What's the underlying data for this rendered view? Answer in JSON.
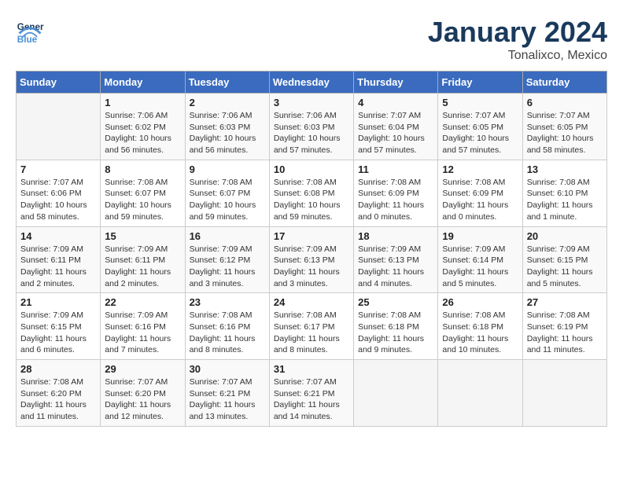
{
  "header": {
    "logo_general": "General",
    "logo_blue": "Blue",
    "title": "January 2024",
    "subtitle": "Tonalixco, Mexico"
  },
  "days_of_week": [
    "Sunday",
    "Monday",
    "Tuesday",
    "Wednesday",
    "Thursday",
    "Friday",
    "Saturday"
  ],
  "weeks": [
    [
      {
        "num": "",
        "sunrise": "",
        "sunset": "",
        "daylight": "",
        "empty": true
      },
      {
        "num": "1",
        "sunrise": "Sunrise: 7:06 AM",
        "sunset": "Sunset: 6:02 PM",
        "daylight": "Daylight: 10 hours and 56 minutes."
      },
      {
        "num": "2",
        "sunrise": "Sunrise: 7:06 AM",
        "sunset": "Sunset: 6:03 PM",
        "daylight": "Daylight: 10 hours and 56 minutes."
      },
      {
        "num": "3",
        "sunrise": "Sunrise: 7:06 AM",
        "sunset": "Sunset: 6:03 PM",
        "daylight": "Daylight: 10 hours and 57 minutes."
      },
      {
        "num": "4",
        "sunrise": "Sunrise: 7:07 AM",
        "sunset": "Sunset: 6:04 PM",
        "daylight": "Daylight: 10 hours and 57 minutes."
      },
      {
        "num": "5",
        "sunrise": "Sunrise: 7:07 AM",
        "sunset": "Sunset: 6:05 PM",
        "daylight": "Daylight: 10 hours and 57 minutes."
      },
      {
        "num": "6",
        "sunrise": "Sunrise: 7:07 AM",
        "sunset": "Sunset: 6:05 PM",
        "daylight": "Daylight: 10 hours and 58 minutes."
      }
    ],
    [
      {
        "num": "7",
        "sunrise": "Sunrise: 7:07 AM",
        "sunset": "Sunset: 6:06 PM",
        "daylight": "Daylight: 10 hours and 58 minutes."
      },
      {
        "num": "8",
        "sunrise": "Sunrise: 7:08 AM",
        "sunset": "Sunset: 6:07 PM",
        "daylight": "Daylight: 10 hours and 59 minutes."
      },
      {
        "num": "9",
        "sunrise": "Sunrise: 7:08 AM",
        "sunset": "Sunset: 6:07 PM",
        "daylight": "Daylight: 10 hours and 59 minutes."
      },
      {
        "num": "10",
        "sunrise": "Sunrise: 7:08 AM",
        "sunset": "Sunset: 6:08 PM",
        "daylight": "Daylight: 10 hours and 59 minutes."
      },
      {
        "num": "11",
        "sunrise": "Sunrise: 7:08 AM",
        "sunset": "Sunset: 6:09 PM",
        "daylight": "Daylight: 11 hours and 0 minutes."
      },
      {
        "num": "12",
        "sunrise": "Sunrise: 7:08 AM",
        "sunset": "Sunset: 6:09 PM",
        "daylight": "Daylight: 11 hours and 0 minutes."
      },
      {
        "num": "13",
        "sunrise": "Sunrise: 7:08 AM",
        "sunset": "Sunset: 6:10 PM",
        "daylight": "Daylight: 11 hours and 1 minute."
      }
    ],
    [
      {
        "num": "14",
        "sunrise": "Sunrise: 7:09 AM",
        "sunset": "Sunset: 6:11 PM",
        "daylight": "Daylight: 11 hours and 2 minutes."
      },
      {
        "num": "15",
        "sunrise": "Sunrise: 7:09 AM",
        "sunset": "Sunset: 6:11 PM",
        "daylight": "Daylight: 11 hours and 2 minutes."
      },
      {
        "num": "16",
        "sunrise": "Sunrise: 7:09 AM",
        "sunset": "Sunset: 6:12 PM",
        "daylight": "Daylight: 11 hours and 3 minutes."
      },
      {
        "num": "17",
        "sunrise": "Sunrise: 7:09 AM",
        "sunset": "Sunset: 6:13 PM",
        "daylight": "Daylight: 11 hours and 3 minutes."
      },
      {
        "num": "18",
        "sunrise": "Sunrise: 7:09 AM",
        "sunset": "Sunset: 6:13 PM",
        "daylight": "Daylight: 11 hours and 4 minutes."
      },
      {
        "num": "19",
        "sunrise": "Sunrise: 7:09 AM",
        "sunset": "Sunset: 6:14 PM",
        "daylight": "Daylight: 11 hours and 5 minutes."
      },
      {
        "num": "20",
        "sunrise": "Sunrise: 7:09 AM",
        "sunset": "Sunset: 6:15 PM",
        "daylight": "Daylight: 11 hours and 5 minutes."
      }
    ],
    [
      {
        "num": "21",
        "sunrise": "Sunrise: 7:09 AM",
        "sunset": "Sunset: 6:15 PM",
        "daylight": "Daylight: 11 hours and 6 minutes."
      },
      {
        "num": "22",
        "sunrise": "Sunrise: 7:09 AM",
        "sunset": "Sunset: 6:16 PM",
        "daylight": "Daylight: 11 hours and 7 minutes."
      },
      {
        "num": "23",
        "sunrise": "Sunrise: 7:08 AM",
        "sunset": "Sunset: 6:16 PM",
        "daylight": "Daylight: 11 hours and 8 minutes."
      },
      {
        "num": "24",
        "sunrise": "Sunrise: 7:08 AM",
        "sunset": "Sunset: 6:17 PM",
        "daylight": "Daylight: 11 hours and 8 minutes."
      },
      {
        "num": "25",
        "sunrise": "Sunrise: 7:08 AM",
        "sunset": "Sunset: 6:18 PM",
        "daylight": "Daylight: 11 hours and 9 minutes."
      },
      {
        "num": "26",
        "sunrise": "Sunrise: 7:08 AM",
        "sunset": "Sunset: 6:18 PM",
        "daylight": "Daylight: 11 hours and 10 minutes."
      },
      {
        "num": "27",
        "sunrise": "Sunrise: 7:08 AM",
        "sunset": "Sunset: 6:19 PM",
        "daylight": "Daylight: 11 hours and 11 minutes."
      }
    ],
    [
      {
        "num": "28",
        "sunrise": "Sunrise: 7:08 AM",
        "sunset": "Sunset: 6:20 PM",
        "daylight": "Daylight: 11 hours and 11 minutes."
      },
      {
        "num": "29",
        "sunrise": "Sunrise: 7:07 AM",
        "sunset": "Sunset: 6:20 PM",
        "daylight": "Daylight: 11 hours and 12 minutes."
      },
      {
        "num": "30",
        "sunrise": "Sunrise: 7:07 AM",
        "sunset": "Sunset: 6:21 PM",
        "daylight": "Daylight: 11 hours and 13 minutes."
      },
      {
        "num": "31",
        "sunrise": "Sunrise: 7:07 AM",
        "sunset": "Sunset: 6:21 PM",
        "daylight": "Daylight: 11 hours and 14 minutes."
      },
      {
        "num": "",
        "sunrise": "",
        "sunset": "",
        "daylight": "",
        "empty": true
      },
      {
        "num": "",
        "sunrise": "",
        "sunset": "",
        "daylight": "",
        "empty": true
      },
      {
        "num": "",
        "sunrise": "",
        "sunset": "",
        "daylight": "",
        "empty": true
      }
    ]
  ]
}
